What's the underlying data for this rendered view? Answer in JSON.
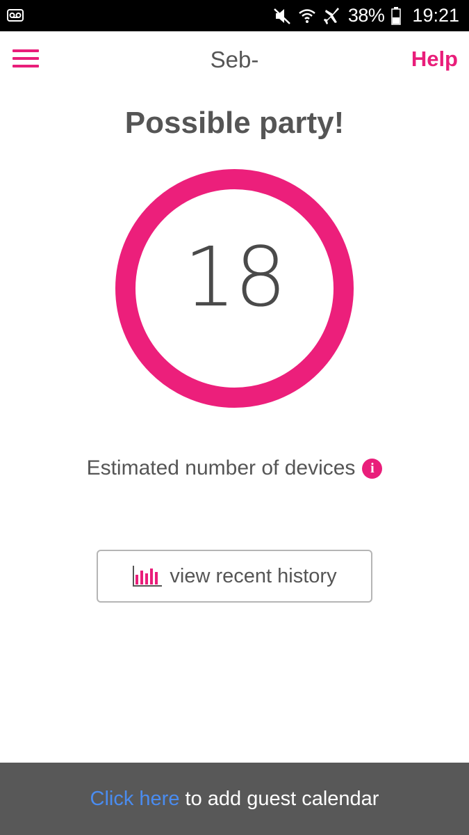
{
  "status_bar": {
    "battery_percent": "38%",
    "time": "19:21",
    "icons": [
      "voicemail-icon",
      "mute-icon",
      "wifi-icon",
      "airplane-icon",
      "battery-icon"
    ]
  },
  "app_bar": {
    "title": "Seb-",
    "help_label": "Help",
    "menu_icon": "hamburger-menu-icon"
  },
  "main": {
    "headline": "Possible party!",
    "device_count": "18",
    "estimate_label": "Estimated number of devices",
    "info_icon_glyph": "i",
    "history_button_label": "view recent history"
  },
  "footer": {
    "link_text": "Click here",
    "rest_text": "to add guest calendar"
  },
  "colors": {
    "accent": "#e91e7a",
    "link": "#4a8cf0",
    "footer_bg": "#585858",
    "text": "#555555"
  }
}
